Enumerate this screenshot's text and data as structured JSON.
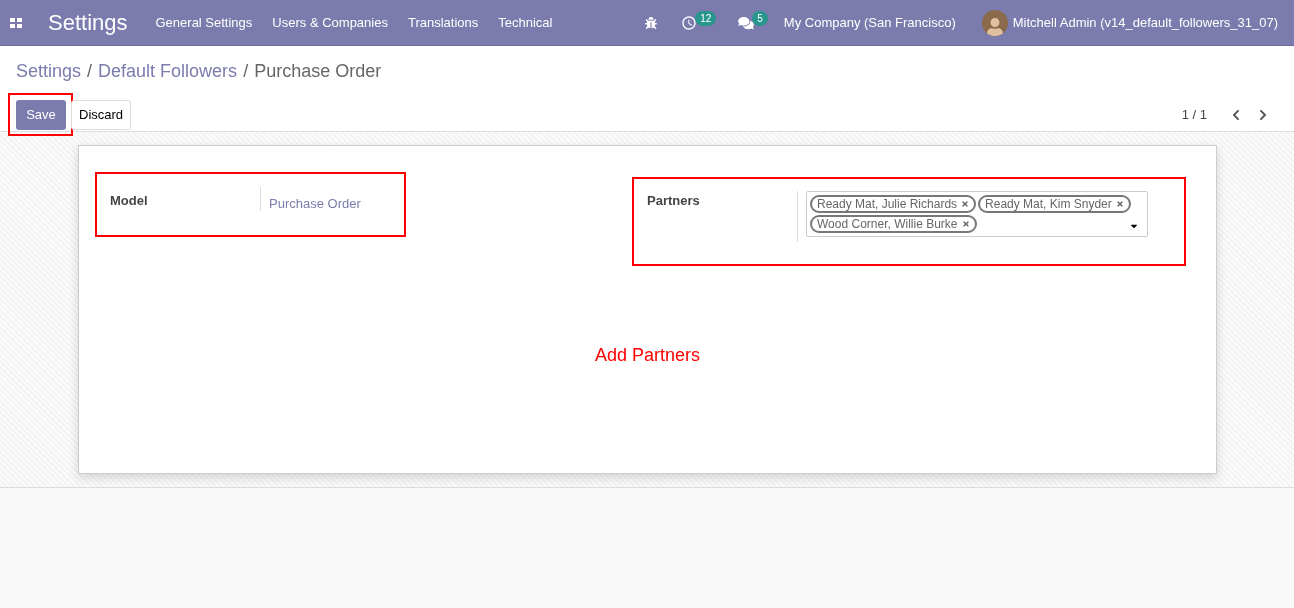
{
  "navbar": {
    "app_title": "Settings",
    "menu": [
      "General Settings",
      "Users & Companies",
      "Translations",
      "Technical"
    ],
    "activities_count": "12",
    "messages_count": "5",
    "company": "My Company (San Francisco)",
    "user": "Mitchell Admin (v14_default_followers_31_07)"
  },
  "breadcrumbs": [
    {
      "label": "Settings",
      "link": true
    },
    {
      "separator": "/",
      "label": "Default Followers",
      "link": true
    },
    {
      "separator": "/",
      "label": "Purchase Order",
      "link": false
    }
  ],
  "buttons": {
    "save": "Save",
    "discard": "Discard"
  },
  "pager": "1 / 1",
  "form": {
    "model": {
      "label": "Model",
      "value": "Purchase Order"
    },
    "partners": {
      "label": "Partners",
      "tags": [
        "Ready Mat, Julie Richards",
        "Ready Mat, Kim Snyder",
        "Wood Corner, Willie Burke"
      ]
    }
  },
  "annotation": "Add Partners"
}
